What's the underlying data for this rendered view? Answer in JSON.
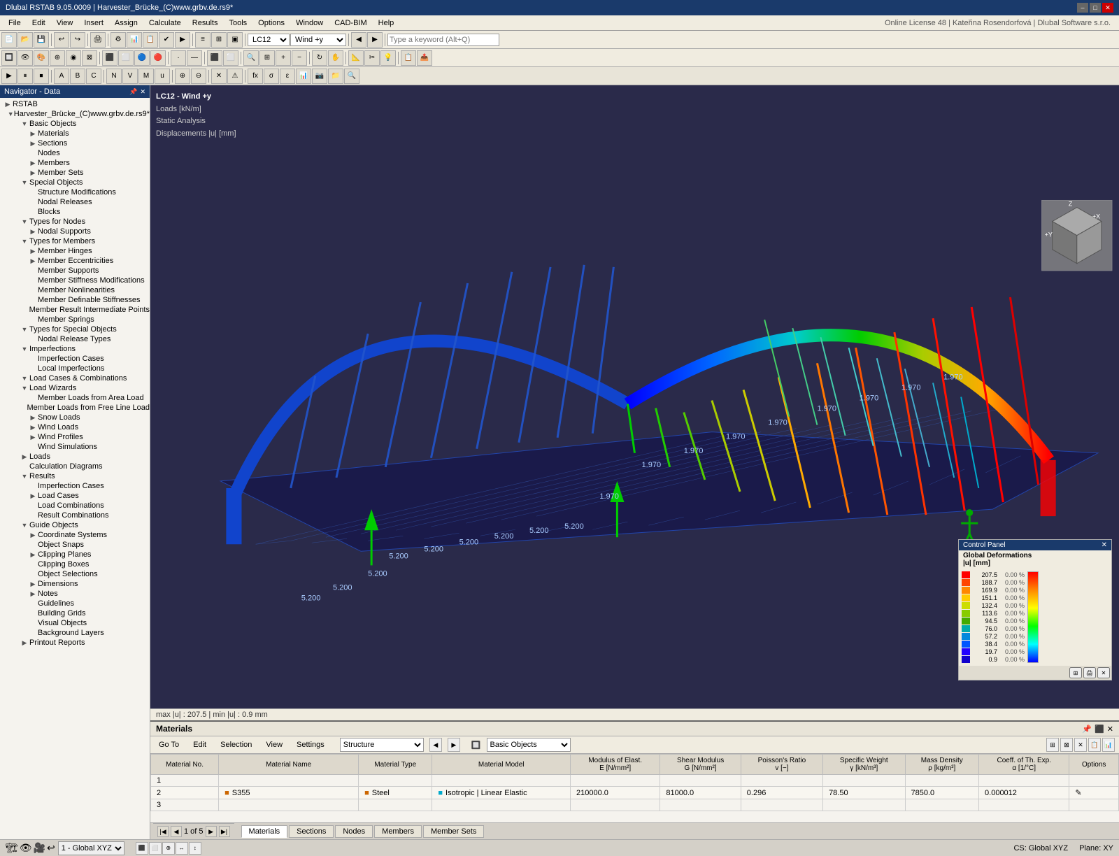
{
  "titleBar": {
    "title": "Dlubal RSTAB 9.05.0009 | Harvester_Brücke_(C)www.grbv.de.rs9*",
    "minimize": "–",
    "maximize": "□",
    "close": "✕"
  },
  "menuBar": {
    "items": [
      "File",
      "Edit",
      "View",
      "Insert",
      "Assign",
      "Calculate",
      "Results",
      "Tools",
      "Options",
      "Window",
      "CAD-BIM",
      "Help"
    ]
  },
  "toolbar1": {
    "lc_label": "LC12",
    "lc_value": "Wind +y",
    "search_placeholder": "Type a keyword (Alt+Q)"
  },
  "licenseInfo": "Online License 48 | Kateřina Rosendorfová | Dlubal Software s.r.o.",
  "navigator": {
    "title": "Navigator - Data",
    "tree": [
      {
        "level": 0,
        "label": "RSTAB",
        "expand": "▶",
        "icon": "🏗"
      },
      {
        "level": 1,
        "label": "Harvester_Brücke_(C)www.grbv.de.rs9*",
        "expand": "▼",
        "icon": "📄"
      },
      {
        "level": 2,
        "label": "Basic Objects",
        "expand": "▼",
        "icon": "📁"
      },
      {
        "level": 3,
        "label": "Materials",
        "expand": "▶",
        "icon": "🟧"
      },
      {
        "level": 3,
        "label": "Sections",
        "expand": "▶",
        "icon": "📐"
      },
      {
        "level": 3,
        "label": "Nodes",
        "expand": "·",
        "icon": "·"
      },
      {
        "level": 3,
        "label": "Members",
        "expand": "▶",
        "icon": "📏"
      },
      {
        "level": 3,
        "label": "Member Sets",
        "expand": "▶",
        "icon": "📏"
      },
      {
        "level": 2,
        "label": "Special Objects",
        "expand": "▼",
        "icon": "📁"
      },
      {
        "level": 3,
        "label": "Structure Modifications",
        "expand": "·",
        "icon": "⚙"
      },
      {
        "level": 3,
        "label": "Nodal Releases",
        "expand": "·",
        "icon": "🔗"
      },
      {
        "level": 3,
        "label": "Blocks",
        "expand": "·",
        "icon": "🟦"
      },
      {
        "level": 2,
        "label": "Types for Nodes",
        "expand": "▼",
        "icon": "📁"
      },
      {
        "level": 3,
        "label": "Nodal Supports",
        "expand": "▶",
        "icon": "△"
      },
      {
        "level": 2,
        "label": "Types for Members",
        "expand": "▼",
        "icon": "📁"
      },
      {
        "level": 3,
        "label": "Member Hinges",
        "expand": "▶",
        "icon": "⊕"
      },
      {
        "level": 3,
        "label": "Member Eccentricities",
        "expand": "▶",
        "icon": "↕"
      },
      {
        "level": 3,
        "label": "Member Supports",
        "expand": "·",
        "icon": "|||"
      },
      {
        "level": 3,
        "label": "Member Stiffness Modifications",
        "expand": "·",
        "icon": "≡"
      },
      {
        "level": 3,
        "label": "Member Nonlinearities",
        "expand": "·",
        "icon": "~"
      },
      {
        "level": 3,
        "label": "Member Definable Stiffnesses",
        "expand": "·",
        "icon": "⊞"
      },
      {
        "level": 3,
        "label": "Member Result Intermediate Points",
        "expand": "·",
        "icon": "⊡"
      },
      {
        "level": 3,
        "label": "Member Springs",
        "expand": "·",
        "icon": "⌒"
      },
      {
        "level": 2,
        "label": "Types for Special Objects",
        "expand": "▼",
        "icon": "📁"
      },
      {
        "level": 3,
        "label": "Nodal Release Types",
        "expand": "·",
        "icon": "🔗"
      },
      {
        "level": 2,
        "label": "Imperfections",
        "expand": "▼",
        "icon": "📁"
      },
      {
        "level": 3,
        "label": "Imperfection Cases",
        "expand": "·",
        "icon": "⚡"
      },
      {
        "level": 3,
        "label": "Local Imperfections",
        "expand": "·",
        "icon": "⚡"
      },
      {
        "level": 2,
        "label": "Load Cases & Combinations",
        "expand": "▼",
        "icon": "📁"
      },
      {
        "level": 2,
        "label": "Load Wizards",
        "expand": "▼",
        "icon": "📁"
      },
      {
        "level": 3,
        "label": "Member Loads from Area Load",
        "expand": "·",
        "icon": "⊠"
      },
      {
        "level": 3,
        "label": "Member Loads from Free Line Load",
        "expand": "·",
        "icon": "⊠"
      },
      {
        "level": 3,
        "label": "Snow Loads",
        "expand": "▶",
        "icon": "❄"
      },
      {
        "level": 3,
        "label": "Wind Loads",
        "expand": "▶",
        "icon": "💨"
      },
      {
        "level": 3,
        "label": "Wind Profiles",
        "expand": "▶",
        "icon": "📊"
      },
      {
        "level": 3,
        "label": "Wind Simulations",
        "expand": "·",
        "icon": "🌀"
      },
      {
        "level": 2,
        "label": "Loads",
        "expand": "▶",
        "icon": "📁"
      },
      {
        "level": 2,
        "label": "Calculation Diagrams",
        "expand": "·",
        "icon": "📈"
      },
      {
        "level": 2,
        "label": "Results",
        "expand": "▼",
        "icon": "📁"
      },
      {
        "level": 3,
        "label": "Imperfection Cases",
        "expand": "·",
        "icon": "⚡"
      },
      {
        "level": 3,
        "label": "Load Cases",
        "expand": "▶",
        "icon": "📋"
      },
      {
        "level": 3,
        "label": "Load Combinations",
        "expand": "·",
        "icon": "📋"
      },
      {
        "level": 3,
        "label": "Result Combinations",
        "expand": "·",
        "icon": "📋"
      },
      {
        "level": 2,
        "label": "Guide Objects",
        "expand": "▼",
        "icon": "📁"
      },
      {
        "level": 3,
        "label": "Coordinate Systems",
        "expand": "▶",
        "icon": "⊕"
      },
      {
        "level": 3,
        "label": "Object Snaps",
        "expand": "·",
        "icon": "🔵"
      },
      {
        "level": 3,
        "label": "Clipping Planes",
        "expand": "▶",
        "icon": "◧"
      },
      {
        "level": 3,
        "label": "Clipping Boxes",
        "expand": "·",
        "icon": "◫"
      },
      {
        "level": 3,
        "label": "Object Selections",
        "expand": "·",
        "icon": "▣"
      },
      {
        "level": 3,
        "label": "Dimensions",
        "expand": "▶",
        "icon": "↔"
      },
      {
        "level": 3,
        "label": "Notes",
        "expand": "▶",
        "icon": "📝"
      },
      {
        "level": 3,
        "label": "Guidelines",
        "expand": "·",
        "icon": "—"
      },
      {
        "level": 3,
        "label": "Building Grids",
        "expand": "·",
        "icon": "⊞"
      },
      {
        "level": 3,
        "label": "Visual Objects",
        "expand": "·",
        "icon": "👁"
      },
      {
        "level": 3,
        "label": "Background Layers",
        "expand": "·",
        "icon": "📄"
      },
      {
        "level": 2,
        "label": "Printout Reports",
        "expand": "▶",
        "icon": "🖨"
      }
    ]
  },
  "viewInfo": {
    "lc": "LC12 - Wind +y",
    "loads": "Loads [kN/m]",
    "analysis": "Static Analysis",
    "displacements": "Displacements |u| [mm]"
  },
  "viewStatus": {
    "text": "max |u| : 207.5 | min |u| : 0.9 mm"
  },
  "controlPanel": {
    "title": "Control Panel",
    "subtitle": "Global Deformations",
    "unit": "|u| [mm]",
    "rows": [
      {
        "color": "#ff0000",
        "val": "207.5",
        "pct": "0.00 %"
      },
      {
        "color": "#ff4400",
        "val": "188.7",
        "pct": "0.00 %"
      },
      {
        "color": "#ff8800",
        "val": "169.9",
        "pct": "0.00 %"
      },
      {
        "color": "#ffcc00",
        "val": "151.1",
        "pct": "0.00 %"
      },
      {
        "color": "#ccdd00",
        "val": "132.4",
        "pct": "0.00 %"
      },
      {
        "color": "#88cc00",
        "val": "113.6",
        "pct": "0.00 %"
      },
      {
        "color": "#44aa00",
        "val": "94.5",
        "pct": "0.00 %"
      },
      {
        "color": "#00aaaa",
        "val": "76.0",
        "pct": "0.00 %"
      },
      {
        "color": "#0088dd",
        "val": "57.2",
        "pct": "0.00 %"
      },
      {
        "color": "#0055ff",
        "val": "38.4",
        "pct": "0.00 %"
      },
      {
        "color": "#2200ff",
        "val": "19.7",
        "pct": "0.00 %"
      },
      {
        "color": "#1100cc",
        "val": "0.9",
        "pct": "0.00 %"
      }
    ]
  },
  "bottomPanel": {
    "title": "Materials",
    "toolbar": {
      "goto": "Go To",
      "edit": "Edit",
      "selection": "Selection",
      "view": "View",
      "settings": "Settings",
      "filter": "Structure",
      "filter2": "Basic Objects"
    },
    "tableHeaders": [
      "Material No.",
      "Material Name",
      "Material Type",
      "Material Model",
      "Modulus of Elast. E [N/mm²]",
      "Shear Modulus G [N/mm²]",
      "Poisson's Ratio v [-]",
      "Specific Weight γ [kN/m³]",
      "Mass Density ρ [kg/m³]",
      "Coeff. of Th. Exp. α [1/°C]",
      "Options"
    ],
    "rows": [
      {
        "no": "1",
        "name": "",
        "type": "",
        "model": "",
        "E": "",
        "G": "",
        "v": "",
        "gamma": "",
        "rho": "",
        "alpha": "",
        "opt": ""
      },
      {
        "no": "2",
        "name": "S355",
        "type": "Steel",
        "model": "Isotropic | Linear Elastic",
        "E": "210000.0",
        "G": "81000.0",
        "v": "0.296",
        "gamma": "78.50",
        "rho": "7850.0",
        "alpha": "0.000012",
        "opt": "✎"
      },
      {
        "no": "3",
        "name": "",
        "type": "",
        "model": "",
        "E": "",
        "G": "",
        "v": "",
        "gamma": "",
        "rho": "",
        "alpha": "",
        "opt": ""
      }
    ]
  },
  "pageNav": {
    "current": "1",
    "total": "5"
  },
  "tabs": [
    "Materials",
    "Sections",
    "Nodes",
    "Members",
    "Member Sets"
  ],
  "statusBar": {
    "item1": "1 - Global XYZ",
    "item2": "CS: Global XYZ",
    "item3": "Plane: XY"
  },
  "bridgeLabels": [
    "5.200",
    "5.200",
    "5.200",
    "5.200",
    "5.200",
    "5.200",
    "5.200",
    "5.200",
    "5.200",
    "1.970",
    "1.970",
    "1.970",
    "1.970",
    "1.970",
    "1.970",
    "1.970",
    "1.970",
    "1.970"
  ]
}
